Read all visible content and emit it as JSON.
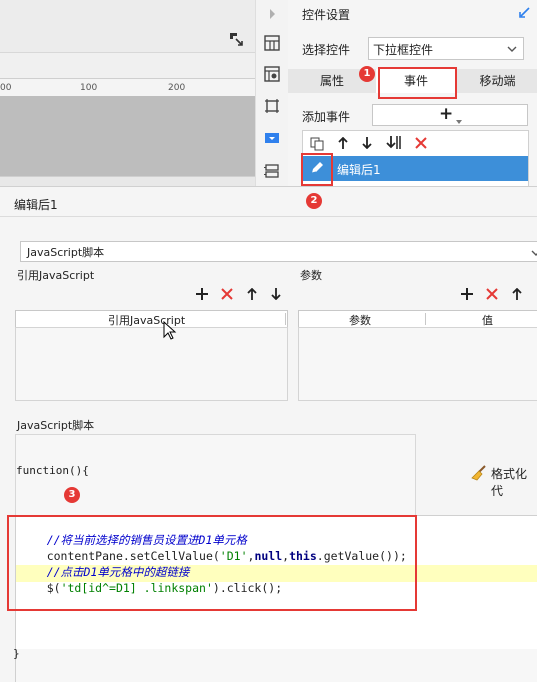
{
  "designer": {
    "ruler_ticks": [
      "00",
      "100",
      "200"
    ],
    "toolbar_icon": "pin-icon"
  },
  "panel": {
    "title": "控件设置",
    "select_widget_label": "选择控件",
    "select_widget_value": "下拉框控件",
    "tabs": [
      {
        "label": "属性",
        "active": false
      },
      {
        "label": "事件",
        "active": true
      },
      {
        "label": "移动端",
        "active": false
      }
    ],
    "add_event_label": "添加事件",
    "add_event_symbol": "+",
    "event_item": "编辑后1",
    "badge1": "1",
    "badge2": "2"
  },
  "dialog": {
    "title": "编辑后1",
    "script_type": "JavaScript脚本",
    "ref_js_section": "引用JavaScript",
    "params_section": "参数",
    "ref_js_column": "引用JavaScript",
    "param_column": "参数",
    "value_column": "值",
    "js_script_section": "JavaScript脚本",
    "function_open": "function(){",
    "function_close": "}",
    "format_button": "格式化代",
    "badge3": "3",
    "code": {
      "line1": "//将当前选择的销售员设置进D1单元格",
      "line2_a": "contentPane.setCellValue(",
      "line2_b": "'D1'",
      "line2_c": ",",
      "line2_d": "null",
      "line2_e": ",",
      "line2_f": "this",
      "line2_g": ".getValue());",
      "line3": "//点击D1单元格中的超链接",
      "line4_a": "$(",
      "line4_b": "'td[id^=D1] .linkspan'",
      "line4_c": ").click();"
    }
  },
  "colors": {
    "accent": "#2f80ed",
    "highlight": "#e53935",
    "selected_row": "#3d8fd9",
    "code_highlight": "#ffffbe"
  }
}
